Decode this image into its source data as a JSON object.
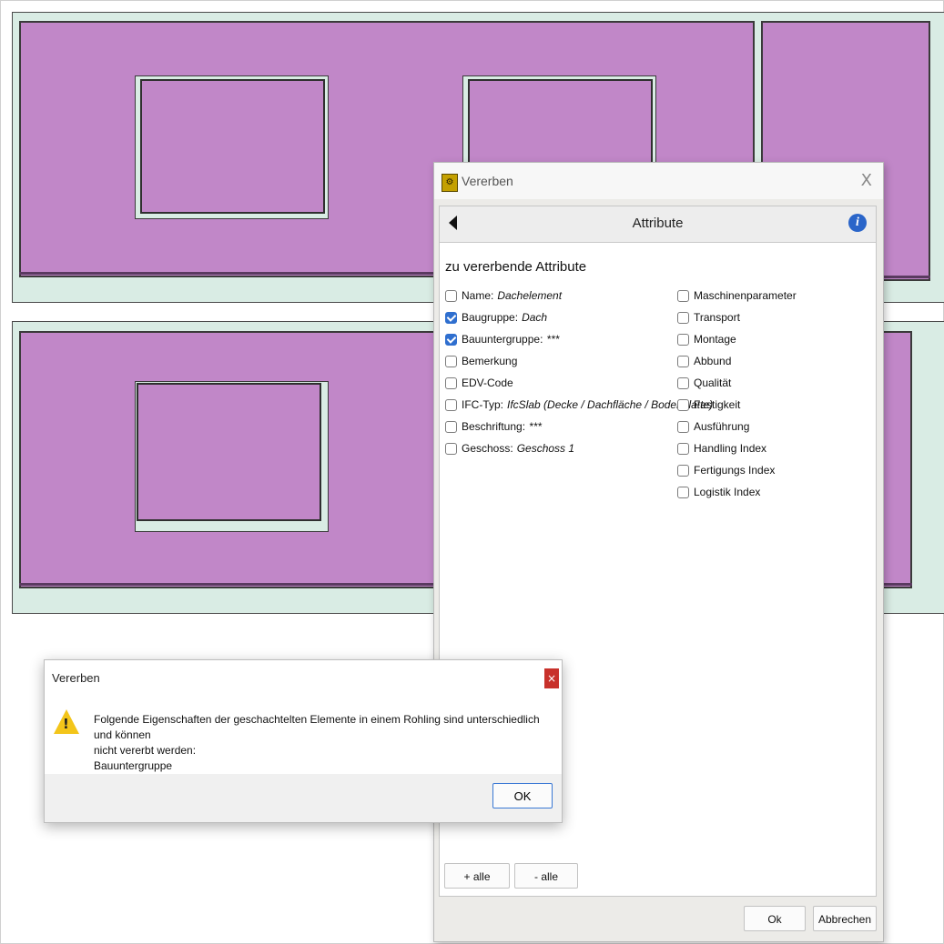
{
  "dialog": {
    "title": "Vererben",
    "close_glyph": "X",
    "app_icon": "vererben-app-icon",
    "header": {
      "title": "Attribute",
      "back_icon": "back-arrow-icon",
      "info_icon": "info-icon",
      "info_glyph": "i"
    },
    "section_title": "zu vererbende Attribute",
    "left_attributes": [
      {
        "label": "Name:",
        "value": "Dachelement",
        "checked": false
      },
      {
        "label": "Baugruppe:",
        "value": "Dach",
        "checked": true
      },
      {
        "label": "Bauuntergruppe:",
        "value": "***",
        "checked": true
      },
      {
        "label": "Bemerkung",
        "value": "",
        "checked": false
      },
      {
        "label": "EDV-Code",
        "value": "",
        "checked": false
      },
      {
        "label": "IFC-Typ:",
        "value": "IfcSlab (Decke / Dachfläche / Bodenplatte)",
        "checked": false
      },
      {
        "label": "Beschriftung:",
        "value": "***",
        "checked": false
      },
      {
        "label": "Geschoss:",
        "value": "Geschoss 1",
        "checked": false
      }
    ],
    "right_attributes": [
      {
        "label": "Maschinenparameter",
        "checked": false
      },
      {
        "label": "Transport",
        "checked": false
      },
      {
        "label": "Montage",
        "checked": false
      },
      {
        "label": "Abbund",
        "checked": false
      },
      {
        "label": "Qualität",
        "checked": false
      },
      {
        "label": "Festigkeit",
        "checked": false
      },
      {
        "label": "Ausführung",
        "checked": false
      },
      {
        "label": "Handling Index",
        "checked": false
      },
      {
        "label": "Fertigungs Index",
        "checked": false
      },
      {
        "label": "Logistik Index",
        "checked": false
      }
    ],
    "plus_all_label": "+ alle",
    "minus_all_label": "- alle",
    "ok_label": "Ok",
    "cancel_label": "Abbrechen"
  },
  "message_box": {
    "title": "Vererben",
    "close_glyph": "×",
    "icon": "warning-icon",
    "icon_glyph": "!",
    "text_line1": "Folgende Eigenschaften der geschachtelten Elemente in einem Rohling sind unterschiedlich und können",
    "text_line2": "nicht vererbt werden:",
    "text_line3": "Bauuntergruppe",
    "ok_label": "OK"
  },
  "colors": {
    "element_fill": "#c187c8",
    "blank_fill": "#d9ece4",
    "checkbox_checked": "#2f6fcf",
    "warning": "#f3c51a",
    "close_red": "#c8312b"
  }
}
